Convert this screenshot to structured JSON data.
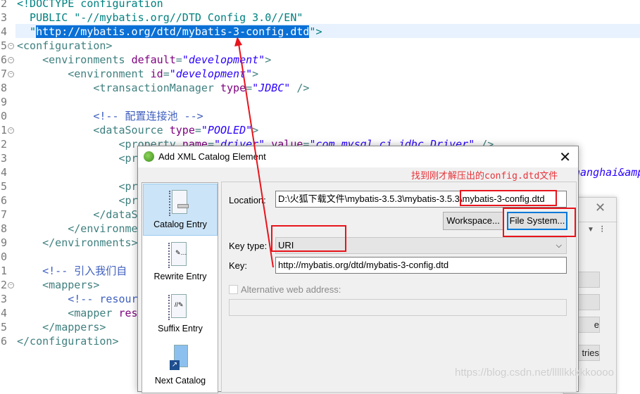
{
  "editor": {
    "line_numbers": [
      "2",
      "3",
      "4",
      "5",
      "6",
      "7",
      "8",
      "9",
      "10",
      "11",
      "12",
      "13",
      "14",
      "15",
      "16",
      "17",
      "18",
      "19",
      "20",
      "21",
      "22",
      "23",
      "24",
      "25",
      "26"
    ],
    "lines": {
      "l2": "<!DOCTYPE configuration",
      "l3": "  PUBLIC \"-//mybatis.org//DTD Config 3.0//EN\"",
      "l4_pre": "  \"",
      "l4_sel": "http://mybatis.org/dtd/mybatis-3-config.dtd",
      "l4_post": "\">",
      "l5": "<configuration>",
      "l6_tag": "    <environments ",
      "l6_attr": "default",
      "l6_val": "\"development\"",
      "l6_end": ">",
      "l7_tag": "        <environment ",
      "l7_attr": "id",
      "l7_val": "\"development\"",
      "l7_end": ">",
      "l8_tag": "            <transactionManager ",
      "l8_attr": "type",
      "l8_val": "\"JDBC\"",
      "l8_end": " />",
      "l10": "            <!-- 配置连接池 -->",
      "l11_tag": "            <dataSource ",
      "l11_attr": "type",
      "l11_val": "\"POOLED\"",
      "l11_end": ">",
      "l12_tag": "                <property ",
      "l12_attr": "name",
      "l12_val": "\"driver\"",
      "l12_attr2": " value",
      "l12_val2": "\"com.mysql.cj.jdbc.Driver\"",
      "l12_end": " />",
      "l13": "                <pr",
      "l14": "nanghai&amp",
      "l15": "                <pr",
      "l16": "                <pr",
      "l17": "            </dataS",
      "l18": "        </environme",
      "l19": "    </environments>",
      "l21": "    <!-- 引入我们自",
      "l22": "    <mappers>",
      "l23": "        <!-- resour",
      "l24_tag": "        <mapper ",
      "l24_attr": "res",
      "l25": "    </mappers>",
      "l26": "</configuration>"
    }
  },
  "background_window": {
    "buttons": [
      "",
      "",
      "e",
      "tries"
    ]
  },
  "dialog": {
    "title": "Add XML Catalog Element",
    "annotation": "找到刚才解压出的config.dtd文件",
    "entries": [
      {
        "label": "Catalog Entry",
        "selected": true
      },
      {
        "label": "Rewrite Entry",
        "selected": false
      },
      {
        "label": "Suffix Entry",
        "selected": false
      },
      {
        "label": "Next Catalog",
        "selected": false
      }
    ],
    "location_label": "Location:",
    "location_value": "D:\\火狐下载文件\\mybatis-3.5.3\\mybatis-3.5.3\\mybatis-3-config.dtd",
    "workspace_button": "Workspace...",
    "filesystem_button": "File System...",
    "key_type_label": "Key type:",
    "key_type_value": "URI",
    "key_label": "Key:",
    "key_value": "http://mybatis.org/dtd/mybatis-3-config.dtd",
    "alt_web_label": "Alternative web address:",
    "alt_web_checked": false,
    "alt_web_value": ""
  },
  "colors": {
    "annotation": "#e8141c",
    "selection": "#0a70d6",
    "selected_entry": "#cce4f7"
  },
  "watermark": "https://blog.csdn.net/lllllkkkkkoooo"
}
